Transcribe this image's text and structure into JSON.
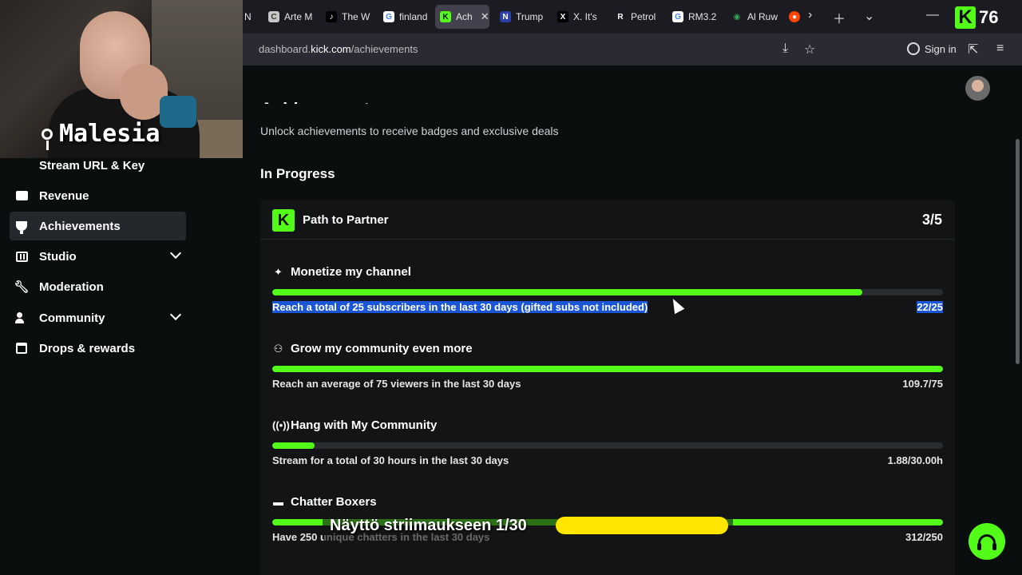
{
  "browser": {
    "tabs": [
      {
        "label": "N",
        "fav": "",
        "fav_bg": "#1c1b22"
      },
      {
        "label": "Arte M",
        "fav": "C",
        "fav_bg": "#c7c7c7"
      },
      {
        "label": "The W",
        "fav": "♪",
        "fav_bg": "#000000"
      },
      {
        "label": "finland",
        "fav": "G",
        "fav_bg": "#ffffff"
      },
      {
        "label": "Ach",
        "fav": "K",
        "fav_bg": "#53fc18"
      },
      {
        "label": "Trump",
        "fav": "N",
        "fav_bg": "#2d3fa8"
      },
      {
        "label": "X. It's",
        "fav": "X",
        "fav_bg": "#000000"
      },
      {
        "label": "Petrol",
        "fav": "R",
        "fav_bg": "#1c1b22"
      },
      {
        "label": "RM3.2",
        "fav": "G",
        "fav_bg": "#ffffff"
      },
      {
        "label": "Al Ruw",
        "fav": "◉",
        "fav_bg": "#1c1b22"
      },
      {
        "label": "",
        "fav": "●",
        "fav_bg": "#ff4500"
      }
    ],
    "kick_badge": "76",
    "url_prefix": "dashboard.",
    "url_domain": "kick.com",
    "url_path": "/achievements",
    "sign_in": "Sign in"
  },
  "webcam": {
    "label": "Malesia"
  },
  "sidebar": {
    "items": [
      {
        "label": "Stream URL & Key",
        "icon": "key-icon"
      },
      {
        "label": "Revenue",
        "icon": "revenue-icon"
      },
      {
        "label": "Achievements",
        "icon": "trophy-icon"
      },
      {
        "label": "Studio",
        "icon": "studio-icon"
      },
      {
        "label": "Moderation",
        "icon": "wrench-icon"
      },
      {
        "label": "Community",
        "icon": "community-icon"
      },
      {
        "label": "Drops & rewards",
        "icon": "calendar-icon"
      }
    ]
  },
  "main": {
    "title": "Achievements",
    "subtitle": "Unlock achievements to receive badges and exclusive deals",
    "section": "In Progress",
    "card": {
      "title": "Path to Partner",
      "count": "3/5",
      "goals": [
        {
          "title": "Monetize my channel",
          "desc": "Reach a total of 25 subscribers in the last 30 days (gifted subs not included)",
          "value": "22/25",
          "progress": 0.88,
          "icon": "sparkle-icon"
        },
        {
          "title": "Grow my community even more",
          "desc": "Reach an average of 75 viewers in the last 30 days",
          "value": "109.7/75",
          "progress": 1.0,
          "icon": "people-icon"
        },
        {
          "title": "Hang with My Community",
          "desc": "Stream for a total of 30 hours in the last 30 days",
          "value": "1.88/30.00h",
          "progress": 0.063,
          "icon": "broadcast-icon"
        },
        {
          "title": "Chatter Boxers",
          "desc": "Have 250 unique chatters in the last 30 days",
          "value": "312/250",
          "progress": 1.0,
          "icon": "chat-icon"
        }
      ]
    }
  },
  "overlay": {
    "banner": "Näyttö striimaukseen 1/30"
  },
  "colors": {
    "accent": "#53fc18",
    "banner": "#ffe600",
    "selection": "#1a56d6"
  }
}
